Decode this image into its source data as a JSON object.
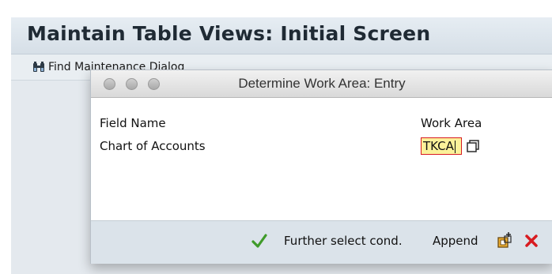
{
  "window": {
    "title": "Maintain Table Views: Initial Screen",
    "toolbar": {
      "find_label": "Find Maintenance Dialog"
    }
  },
  "dialog": {
    "title": "Determine Work Area: Entry",
    "headers": {
      "field_name": "Field Name",
      "work_area": "Work Area"
    },
    "row": {
      "field": "Chart of Accounts",
      "value": "TKCA"
    },
    "footer": {
      "further_select": "Further select cond.",
      "append": "Append"
    },
    "icons": {
      "continue": "checkmark-icon",
      "multiple_selection": "multiple-selection-icon",
      "new_entries": "new-entries-icon",
      "cancel": "cancel-icon"
    },
    "colors": {
      "input_bg": "#fbf19a",
      "input_border": "#d81b20",
      "continue": "#3f9b2a",
      "cancel": "#d81b20"
    }
  }
}
